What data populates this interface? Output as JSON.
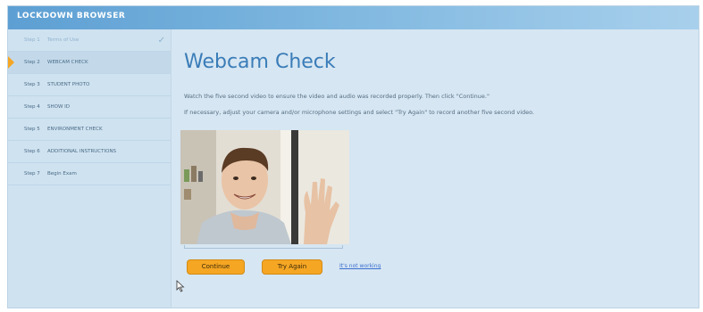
{
  "window": {
    "title": "LOCKDOWN BROWSER"
  },
  "sidebar": {
    "steps": [
      {
        "num": "Step 1",
        "label": "Terms of Use"
      },
      {
        "num": "Step 2",
        "label": "WEBCAM CHECK"
      },
      {
        "num": "Step 3",
        "label": "STUDENT PHOTO"
      },
      {
        "num": "Step 4",
        "label": "SHOW ID"
      },
      {
        "num": "Step 5",
        "label": "ENVIRONMENT CHECK"
      },
      {
        "num": "Step 6",
        "label": "ADDITIONAL INSTRUCTIONS"
      },
      {
        "num": "Step 7",
        "label": "Begin Exam"
      }
    ],
    "completed_check": "✓"
  },
  "main": {
    "title": "Webcam Check",
    "instruction_1": "Watch the five second video to ensure the video and audio was recorded properly. Then click \"Continue.\"",
    "instruction_2": "If necessary, adjust your camera and/or microphone settings and select \"Try Again\" to record another five second video.",
    "continue_label": "Continue",
    "try_again_label": "Try Again",
    "not_working_link": "It's not working"
  },
  "colors": {
    "accent": "#3a7cb8",
    "button": "#f5a623",
    "sidebar": "#cfe2f0",
    "background": "#d6e6f2"
  }
}
